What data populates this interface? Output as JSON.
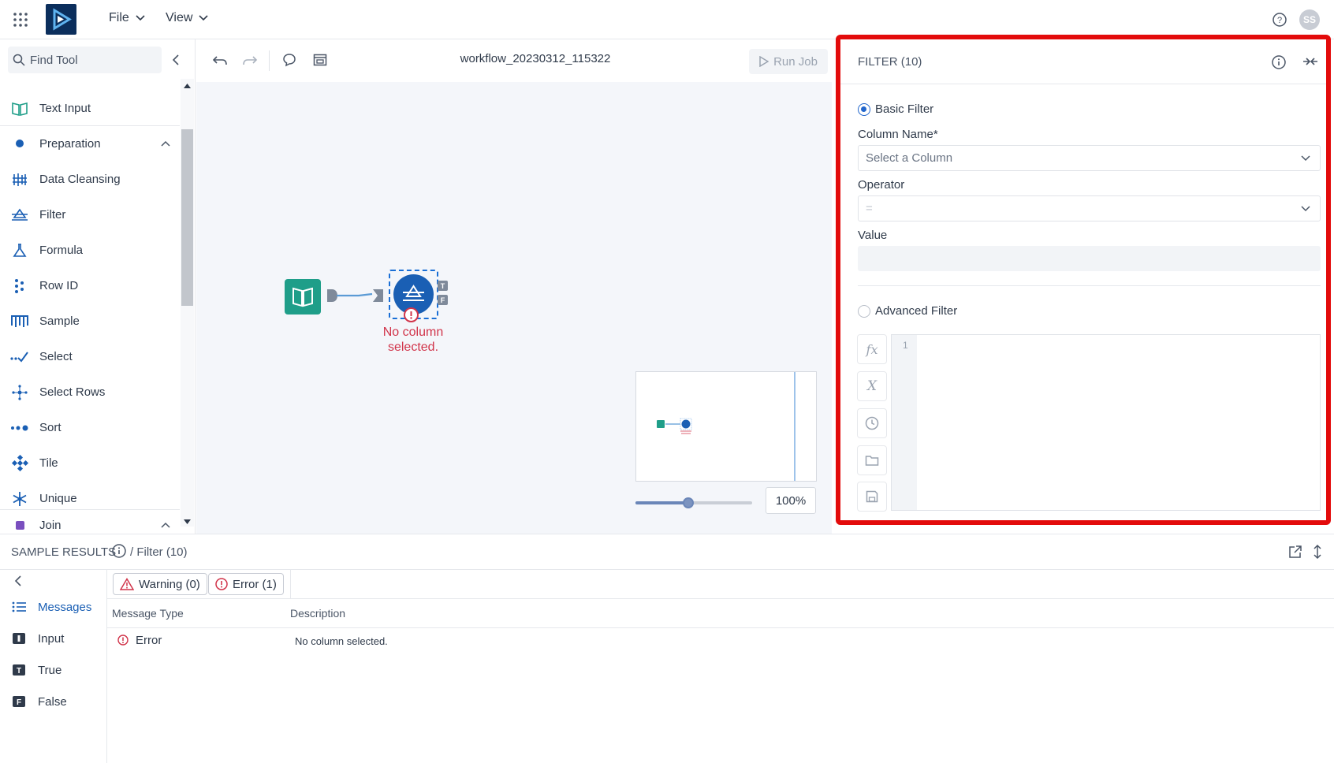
{
  "header": {
    "menus": [
      "File",
      "View"
    ],
    "user_initials": "SS"
  },
  "toolpanel": {
    "search_placeholder": "Find Tool",
    "items": [
      {
        "label": "Text Input",
        "icon": "book-icon",
        "kind": "tool"
      },
      {
        "label": "Preparation",
        "icon": "category-dot-icon",
        "kind": "category"
      },
      {
        "label": "Data Cleansing",
        "icon": "data-cleansing-icon",
        "kind": "tool"
      },
      {
        "label": "Filter",
        "icon": "filter-icon",
        "kind": "tool"
      },
      {
        "label": "Formula",
        "icon": "formula-flask-icon",
        "kind": "tool"
      },
      {
        "label": "Row ID",
        "icon": "row-id-icon",
        "kind": "tool"
      },
      {
        "label": "Sample",
        "icon": "sample-icon",
        "kind": "tool"
      },
      {
        "label": "Select",
        "icon": "select-check-icon",
        "kind": "tool"
      },
      {
        "label": "Select Rows",
        "icon": "select-rows-icon",
        "kind": "tool"
      },
      {
        "label": "Sort",
        "icon": "sort-dots-icon",
        "kind": "tool"
      },
      {
        "label": "Tile",
        "icon": "tile-icon",
        "kind": "tool"
      },
      {
        "label": "Unique",
        "icon": "unique-snowflake-icon",
        "kind": "tool"
      },
      {
        "label": "Join",
        "icon": "category-square-icon",
        "kind": "category"
      }
    ]
  },
  "canvas": {
    "workflow_name": "workflow_20230312_115322",
    "run_job_label": "Run Job",
    "node_error_line1": "No column",
    "node_error_line2": "selected.",
    "zoom_label": "100%",
    "zoom_level": 0.45
  },
  "filter_panel": {
    "title": "FILTER (10)",
    "basic_filter_label": "Basic Filter",
    "column_name_label": "Column Name*",
    "column_placeholder": "Select a Column",
    "operator_label": "Operator",
    "operator_value": "=",
    "value_label": "Value",
    "advanced_filter_label": "Advanced Filter",
    "editor_line_number": "1",
    "side_buttons": [
      "fx-icon",
      "x-variable-icon",
      "clock-icon",
      "folder-icon",
      "save-icon"
    ]
  },
  "results": {
    "title": "SAMPLE RESULTS",
    "breadcrumb": "/ Filter (10)",
    "nav": [
      "Messages",
      "Input",
      "True",
      "False"
    ],
    "warning_chip": "Warning (0)",
    "error_chip": "Error (1)",
    "columns": [
      "Message Type",
      "Description"
    ],
    "rows": [
      {
        "type": "Error",
        "description": "No column selected."
      }
    ]
  },
  "colors": {
    "accent": "#1a5fb4",
    "error": "#d1344a",
    "highlight_frame": "#e30b0b",
    "teal_node": "#1f9e89"
  }
}
